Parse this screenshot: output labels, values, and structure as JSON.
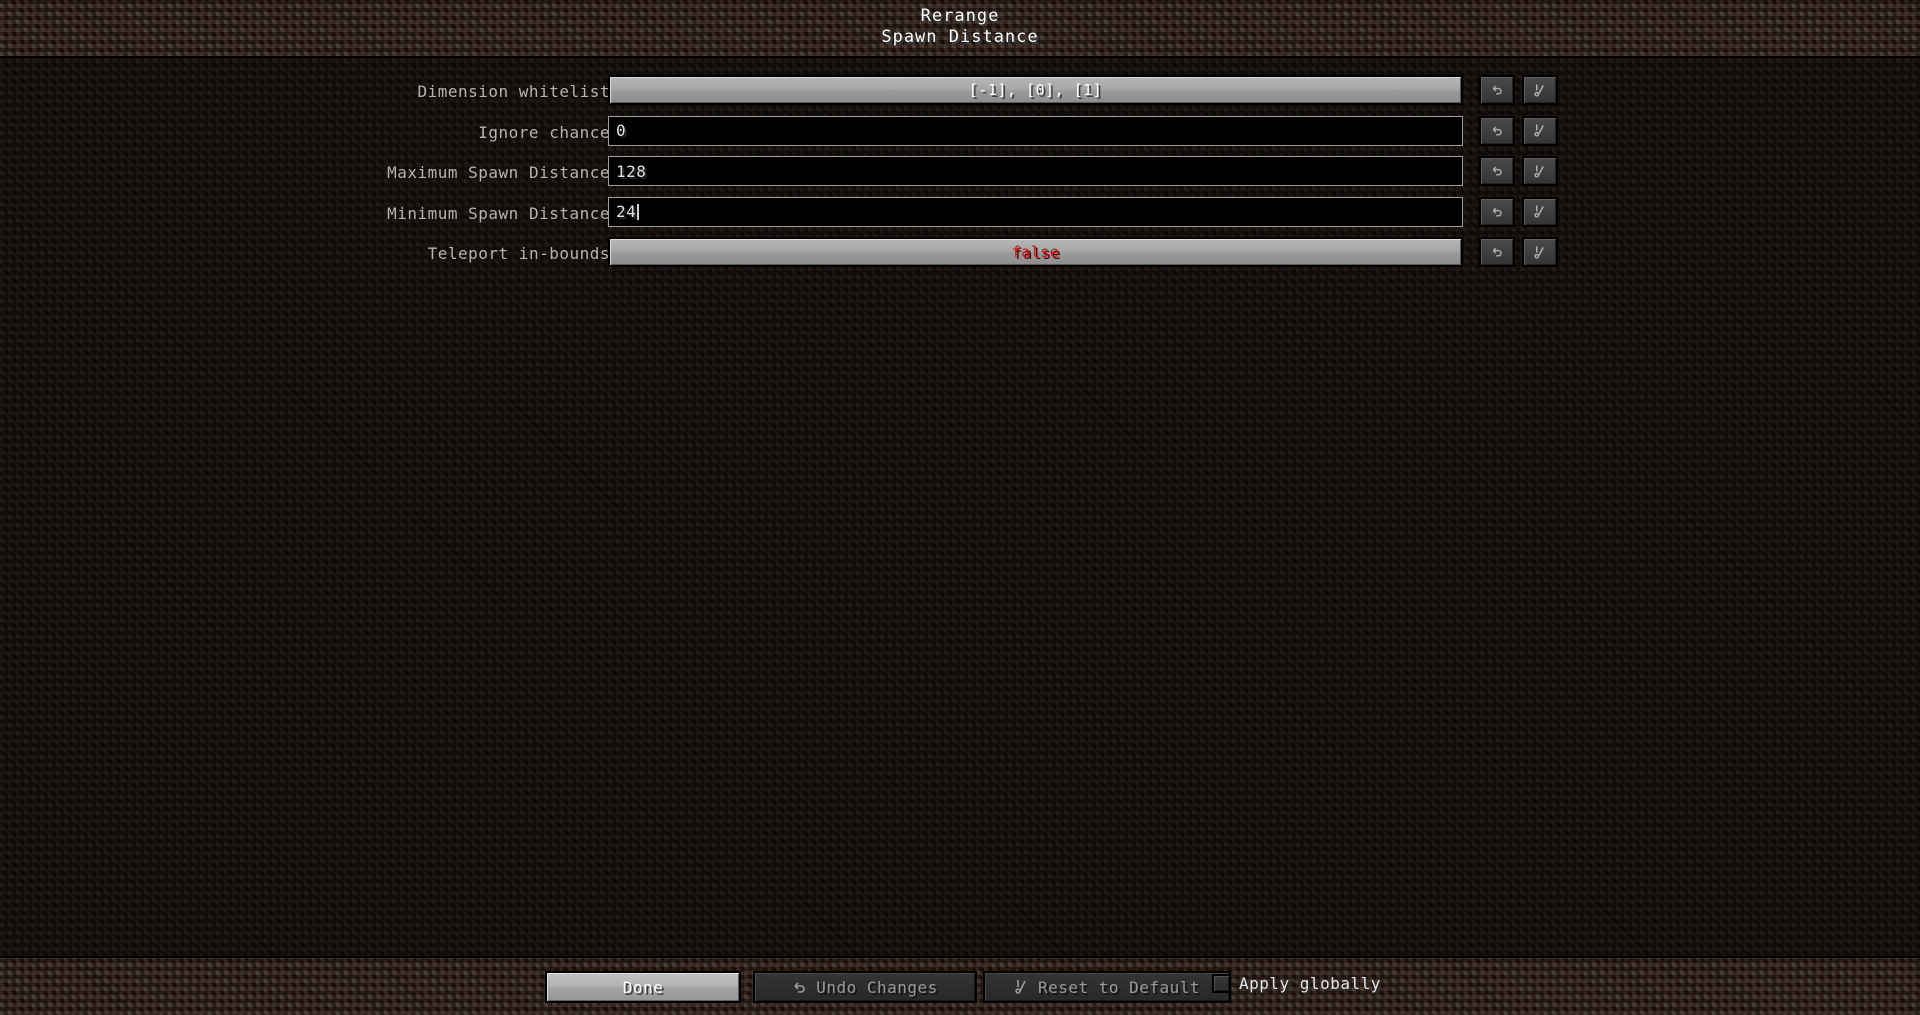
{
  "header": {
    "title": "Rerange",
    "subtitle": "Spawn Distance"
  },
  "colors": {
    "accent_false": "#d80f0f",
    "label": "#b9b3ac",
    "bar": "#2b1d15",
    "background": "#140e0b"
  },
  "rows": [
    {
      "label": "Dimension whitelist",
      "control": "button",
      "value": "[-1], [0], [1]",
      "undo_icon": "undo-arrow-icon",
      "reset_icon": "reset-default-icon"
    },
    {
      "label": "Ignore chance",
      "control": "input",
      "value": "0",
      "caret": false,
      "undo_icon": "undo-arrow-icon",
      "reset_icon": "reset-default-icon"
    },
    {
      "label": "Maximum Spawn Distance",
      "control": "input",
      "value": "128",
      "caret": false,
      "undo_icon": "undo-arrow-icon",
      "reset_icon": "reset-default-icon"
    },
    {
      "label": "Minimum Spawn Distance",
      "control": "input",
      "value": "24",
      "caret": true,
      "undo_icon": "undo-arrow-icon",
      "reset_icon": "reset-default-icon"
    },
    {
      "label": "Teleport in-bounds",
      "control": "button",
      "value": "false",
      "value_color": "#d80f0f",
      "undo_icon": "undo-arrow-icon",
      "reset_icon": "reset-default-icon"
    }
  ],
  "footer": {
    "done_label": "Done",
    "undo_label": "Undo Changes",
    "undo_icon": "undo-arrow-icon",
    "reset_label": "Reset to Default",
    "reset_icon": "reset-default-icon",
    "apply_globally_label": "Apply globally",
    "apply_globally_checked": false
  }
}
